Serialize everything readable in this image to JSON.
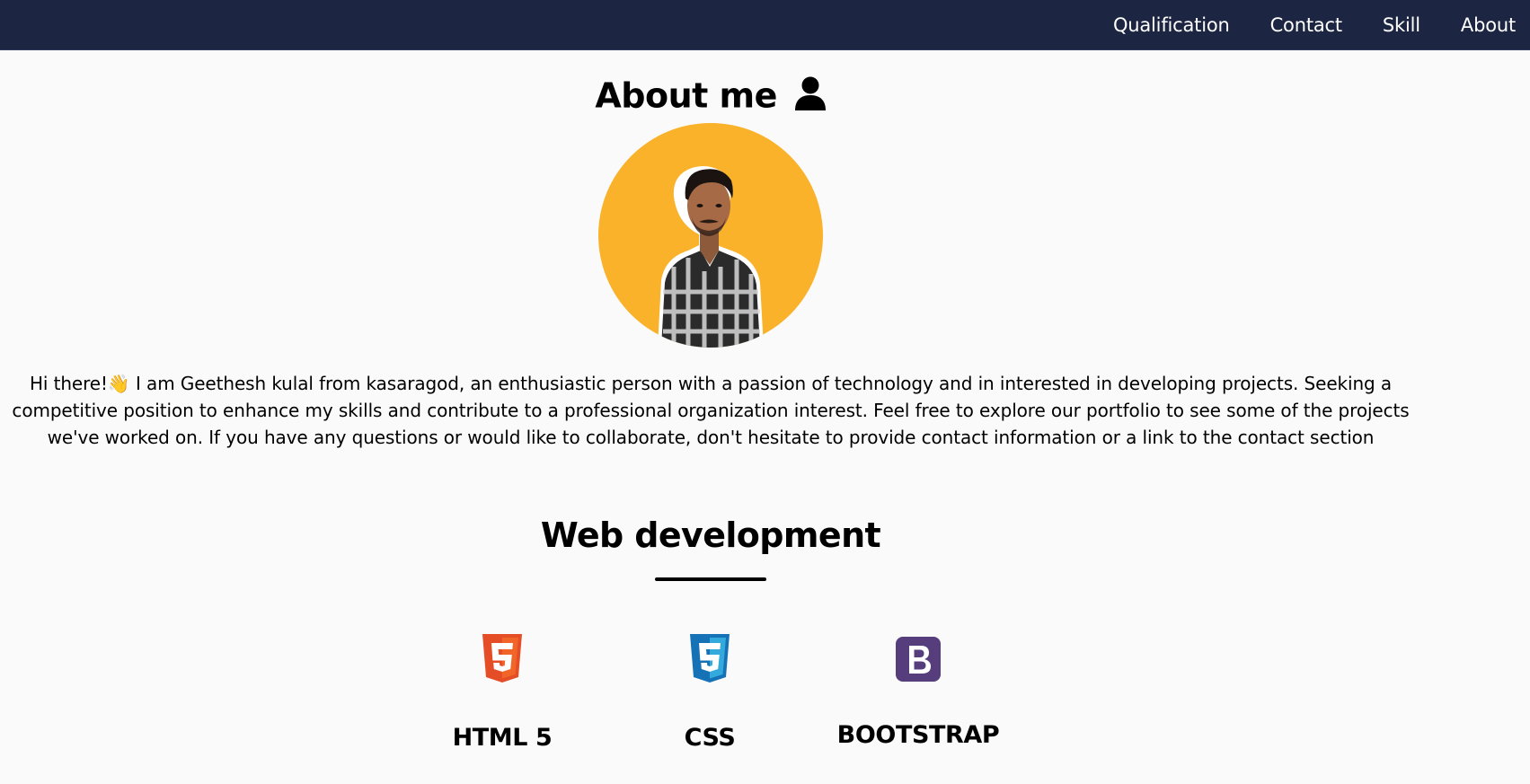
{
  "nav": {
    "items": [
      {
        "label": "Qualification"
      },
      {
        "label": "Contact"
      },
      {
        "label": "Skill"
      },
      {
        "label": "About"
      }
    ]
  },
  "about": {
    "title": "About me",
    "text": "Hi there!👋 I am Geethesh kulal from kasaragod, an enthusiastic person with a passion of technology and in interested in developing projects. Seeking a competitive position to enhance my skills and contribute to a professional organization interest. Feel free to explore our portfolio to see some of the projects we've worked on. If you have any questions or would like to collaborate, don't hesitate to provide contact information or a link to the contact section"
  },
  "skills_section": {
    "title": "Web development",
    "items": [
      {
        "label": "HTML 5",
        "icon": "html5-icon",
        "color": "#e44d26"
      },
      {
        "label": "CSS",
        "icon": "css3-icon",
        "color": "#2196f3"
      },
      {
        "label": "BOOTSTRAP",
        "icon": "bootstrap-icon",
        "color": "#563d7c"
      }
    ]
  },
  "colors": {
    "navbar": "#1c2541",
    "profile_background": "#f9b22a",
    "page_background": "#fafafa"
  }
}
